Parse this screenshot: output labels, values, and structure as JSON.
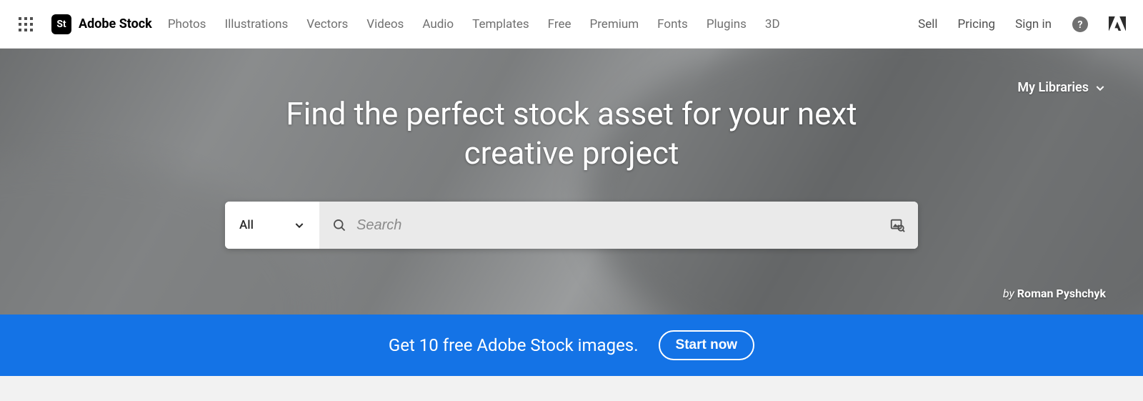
{
  "brand": {
    "badge": "St",
    "name": "Adobe Stock"
  },
  "nav": {
    "items": [
      "Photos",
      "Illustrations",
      "Vectors",
      "Videos",
      "Audio",
      "Templates",
      "Free",
      "Premium",
      "Fonts",
      "Plugins",
      "3D"
    ]
  },
  "header_right": {
    "sell": "Sell",
    "pricing": "Pricing",
    "signin": "Sign in"
  },
  "hero": {
    "libraries_label": "My Libraries",
    "headline": "Find the perfect stock asset for your next creative project",
    "search": {
      "category_selected": "All",
      "placeholder": "Search"
    },
    "credit_prefix": "by ",
    "credit_name": "Roman Pyshchyk"
  },
  "promo": {
    "text": "Get 10 free Adobe Stock images.",
    "button": "Start now"
  }
}
